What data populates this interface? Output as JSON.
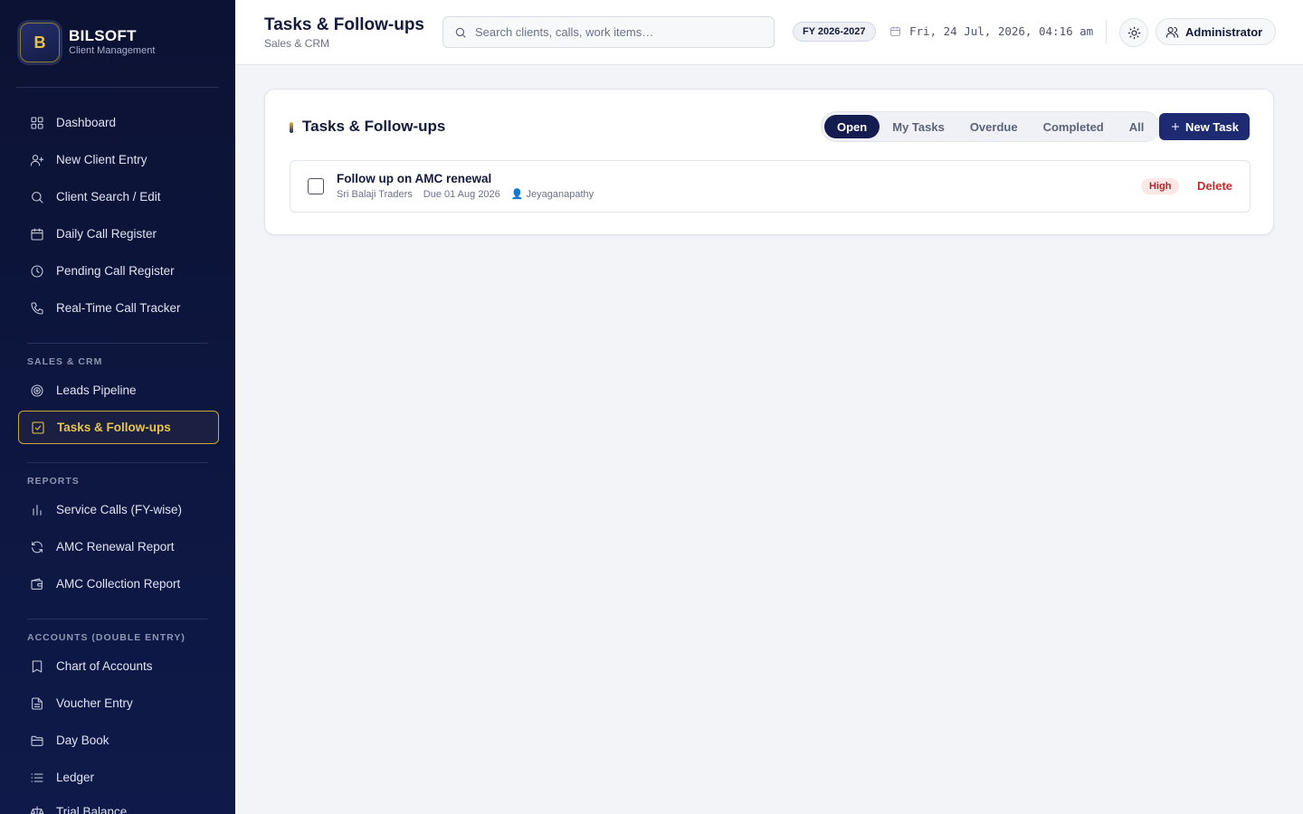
{
  "brand": {
    "logo_letter": "B",
    "name": "BILSOFT",
    "subtitle": "Client Management"
  },
  "sidebar": {
    "main_items": [
      {
        "label": "Dashboard",
        "icon": "grid-icon"
      },
      {
        "label": "New Client Entry",
        "icon": "user-plus-icon"
      },
      {
        "label": "Client Search / Edit",
        "icon": "search-icon"
      },
      {
        "label": "Daily Call Register",
        "icon": "calendar-icon"
      },
      {
        "label": "Pending Call Register",
        "icon": "clock-icon"
      },
      {
        "label": "Real-Time Call Tracker",
        "icon": "phone-icon"
      }
    ],
    "sales_title": "SALES & CRM",
    "sales_items": [
      {
        "label": "Leads Pipeline",
        "icon": "target-icon"
      },
      {
        "label": "Tasks & Follow-ups",
        "icon": "check-square-icon",
        "active": true
      }
    ],
    "reports_title": "REPORTS",
    "reports_items": [
      {
        "label": "Service Calls (FY-wise)",
        "icon": "bar-chart-icon"
      },
      {
        "label": "AMC Renewal Report",
        "icon": "refresh-icon"
      },
      {
        "label": "AMC Collection Report",
        "icon": "wallet-icon"
      }
    ],
    "accounts_title": "ACCOUNTS (DOUBLE ENTRY)",
    "accounts_items": [
      {
        "label": "Chart of Accounts",
        "icon": "book-icon"
      },
      {
        "label": "Voucher Entry",
        "icon": "file-text-icon"
      },
      {
        "label": "Day Book",
        "icon": "folder-open-icon"
      },
      {
        "label": "Ledger",
        "icon": "list-icon"
      },
      {
        "label": "Trial Balance",
        "icon": "scale-icon"
      }
    ]
  },
  "header": {
    "title": "Tasks & Follow-ups",
    "subtitle": "Sales & CRM",
    "search_placeholder": "Search clients, calls, work items…",
    "fy": "FY 2026-2027",
    "datetime": "Fri, 24 Jul, 2026, 04:16 am",
    "user": "Administrator"
  },
  "card": {
    "title": "Tasks & Follow-ups",
    "filters": [
      "Open",
      "My Tasks",
      "Overdue",
      "Completed",
      "All"
    ],
    "active_filter": "Open",
    "new_task_label": "New Task",
    "tasks": [
      {
        "title": "Follow up on AMC renewal",
        "client": "Sri Balaji Traders",
        "due": "Due 01 Aug 2026",
        "assignee": "Jeyaganapathy",
        "priority": "High",
        "delete_label": "Delete"
      }
    ]
  },
  "colors": {
    "sidebar_bg": "#0b1233",
    "accent_gold": "#e8c44e",
    "primary": "#1e2a72",
    "danger": "#c52a2f"
  }
}
